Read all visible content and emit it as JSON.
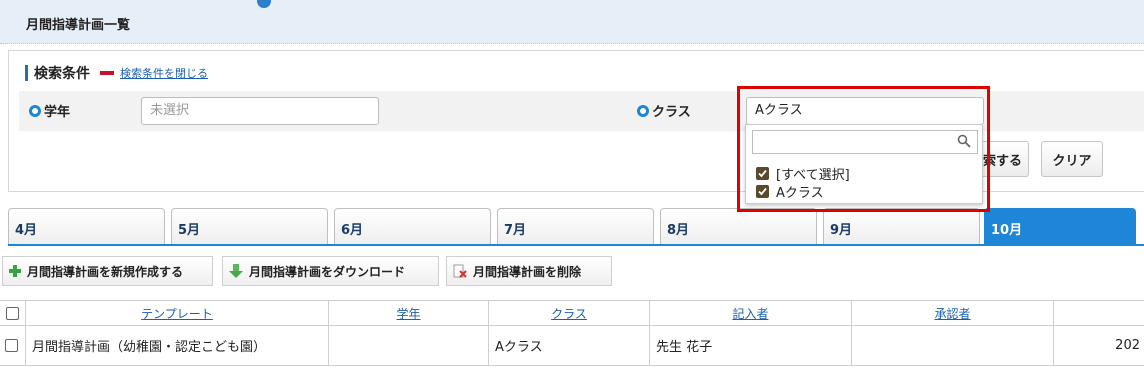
{
  "page": {
    "title": "月間指導計画一覧"
  },
  "search": {
    "heading": "検索条件",
    "close_link": "検索条件を閉じる",
    "grade_label": "学年",
    "grade_placeholder": "未選択",
    "class_label": "クラス",
    "class_value": "Aクラス",
    "search_button_partial": "索する",
    "clear_button": "クリア"
  },
  "dropdown": {
    "options": [
      {
        "label": "[すべて選択]",
        "checked": true
      },
      {
        "label": "Aクラス",
        "checked": true
      }
    ]
  },
  "tabs": [
    {
      "label": "4月",
      "active": false
    },
    {
      "label": "5月",
      "active": false
    },
    {
      "label": "6月",
      "active": false
    },
    {
      "label": "7月",
      "active": false
    },
    {
      "label": "8月",
      "active": false
    },
    {
      "label": "9月",
      "active": false
    },
    {
      "label": "10月",
      "active": true
    }
  ],
  "actions": {
    "create": "月間指導計画を新規作成する",
    "download": "月間指導計画をダウンロード",
    "delete": "月間指導計画を削除"
  },
  "table": {
    "columns": [
      "テンプレート",
      "学年",
      "クラス",
      "記入者",
      "承認者"
    ],
    "rows": [
      {
        "template": "月間指導計画（幼稚園・認定こども園）",
        "grade": "",
        "class": "Aクラス",
        "writer": "先生 花子",
        "approver": "",
        "date_partial": "202"
      }
    ]
  },
  "colors": {
    "accent": "#1e86d6",
    "highlight": "#e00000",
    "link": "#1a5fb4"
  }
}
